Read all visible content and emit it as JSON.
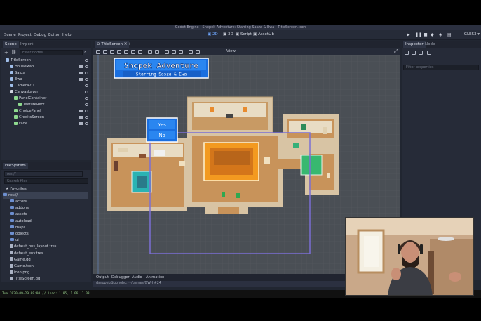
{
  "window": {
    "title": "Godot Engine - Snopek Adventure: Starring Sasza & Ewa - TitleScreen.tscn"
  },
  "menu": [
    "Scene",
    "Project",
    "Debug",
    "Editor",
    "Help"
  ],
  "modes": [
    "2D",
    "3D",
    "Script",
    "AssetLib"
  ],
  "renderer": "GLES3",
  "scene_dock": {
    "tabs": [
      "Scene",
      "Import"
    ],
    "filter_placeholder": "Filter nodes",
    "nodes": [
      {
        "name": "TitleScreen",
        "color": "#9fbde8",
        "depth": 0
      },
      {
        "name": "HouseMap",
        "color": "#9fbde8",
        "depth": 1
      },
      {
        "name": "Sasza",
        "color": "#9fbde8",
        "depth": 1
      },
      {
        "name": "Ewa",
        "color": "#9fbde8",
        "depth": 1
      },
      {
        "name": "Camera2D",
        "color": "#9fbde8",
        "depth": 1
      },
      {
        "name": "CanvasLayer",
        "color": "#cfd3dd",
        "depth": 1
      },
      {
        "name": "PanelContainer",
        "color": "#8eda8e",
        "depth": 2
      },
      {
        "name": "TextureRect",
        "color": "#8eda8e",
        "depth": 3
      },
      {
        "name": "ChoicePanel",
        "color": "#8eda8e",
        "depth": 2
      },
      {
        "name": "CreditsScreen",
        "color": "#8eda8e",
        "depth": 2
      },
      {
        "name": "Fade",
        "color": "#8eda8e",
        "depth": 2
      }
    ]
  },
  "filesystem": {
    "tab": "FileSystem",
    "path": "res://",
    "search_placeholder": "Search files",
    "favorites": "Favorites:",
    "root": "res://",
    "folders": [
      "actors",
      "addons",
      "assets",
      "autoload",
      "maps",
      "objects",
      "ui"
    ],
    "files": [
      "default_bus_layout.tres",
      "default_env.tres",
      "Game.gd",
      "Game.tscn",
      "icon.png",
      "TitleScreen.gd"
    ]
  },
  "editor": {
    "scene_tab": "TitleScreen",
    "view_label": "View",
    "title_main": "Snopek Adventure",
    "title_sub": "Starring Sasza & Ewa",
    "choices": [
      "Yes",
      "No"
    ]
  },
  "bottom_tabs": [
    "Output",
    "Debugger",
    "Audio",
    "Animation"
  ],
  "inspector": {
    "tabs": [
      "Inspector",
      "Node"
    ],
    "filter_placeholder": "Filter properties"
  },
  "status_text": "dsnopek@bonobo: ~/games/GW-J #24",
  "terminal_line": "Tue 2020-09-29 09:00 // load: 1.05, 1.06, 1.03"
}
